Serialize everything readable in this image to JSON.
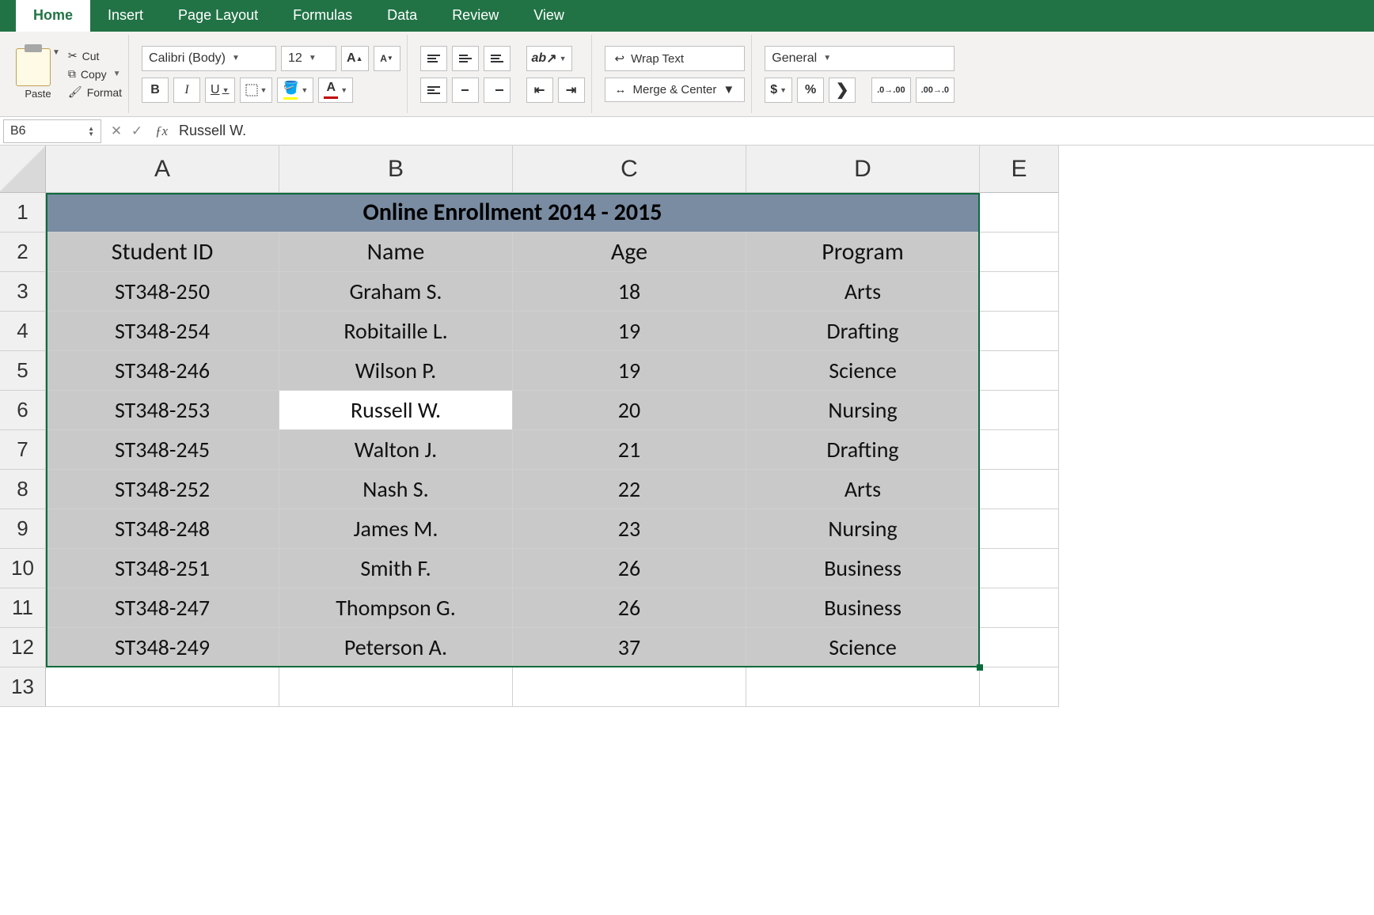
{
  "menu": {
    "tabs": [
      "Home",
      "Insert",
      "Page Layout",
      "Formulas",
      "Data",
      "Review",
      "View"
    ],
    "active": "Home"
  },
  "ribbon": {
    "paste_label": "Paste",
    "cut_label": "Cut",
    "copy_label": "Copy",
    "format_label": "Format",
    "font_name": "Calibri (Body)",
    "font_size": "12",
    "wrap_text_label": "Wrap Text",
    "merge_center_label": "Merge & Center",
    "number_format": "General"
  },
  "formula_bar": {
    "name_box": "B6",
    "formula_value": "Russell W."
  },
  "sheet": {
    "col_letters": [
      "A",
      "B",
      "C",
      "D",
      "E"
    ],
    "row_numbers": [
      "1",
      "2",
      "3",
      "4",
      "5",
      "6",
      "7",
      "8",
      "9",
      "10",
      "11",
      "12",
      "13"
    ],
    "title": "Online Enrollment 2014 - 2015",
    "headers": [
      "Student ID",
      "Name",
      "Age",
      "Program"
    ],
    "rows": [
      {
        "id": "ST348-250",
        "name": "Graham S.",
        "age": "18",
        "program": "Arts"
      },
      {
        "id": "ST348-254",
        "name": "Robitaille L.",
        "age": "19",
        "program": "Drafting"
      },
      {
        "id": "ST348-246",
        "name": "Wilson P.",
        "age": "19",
        "program": "Science"
      },
      {
        "id": "ST348-253",
        "name": "Russell W.",
        "age": "20",
        "program": "Nursing"
      },
      {
        "id": "ST348-245",
        "name": "Walton J.",
        "age": "21",
        "program": "Drafting"
      },
      {
        "id": "ST348-252",
        "name": "Nash S.",
        "age": "22",
        "program": "Arts"
      },
      {
        "id": "ST348-248",
        "name": "James M.",
        "age": "23",
        "program": "Nursing"
      },
      {
        "id": "ST348-251",
        "name": "Smith F.",
        "age": "26",
        "program": "Business"
      },
      {
        "id": "ST348-247",
        "name": "Thompson G.",
        "age": "26",
        "program": "Business"
      },
      {
        "id": "ST348-249",
        "name": "Peterson A.",
        "age": "37",
        "program": "Science"
      }
    ],
    "selected_cell": "B6"
  }
}
